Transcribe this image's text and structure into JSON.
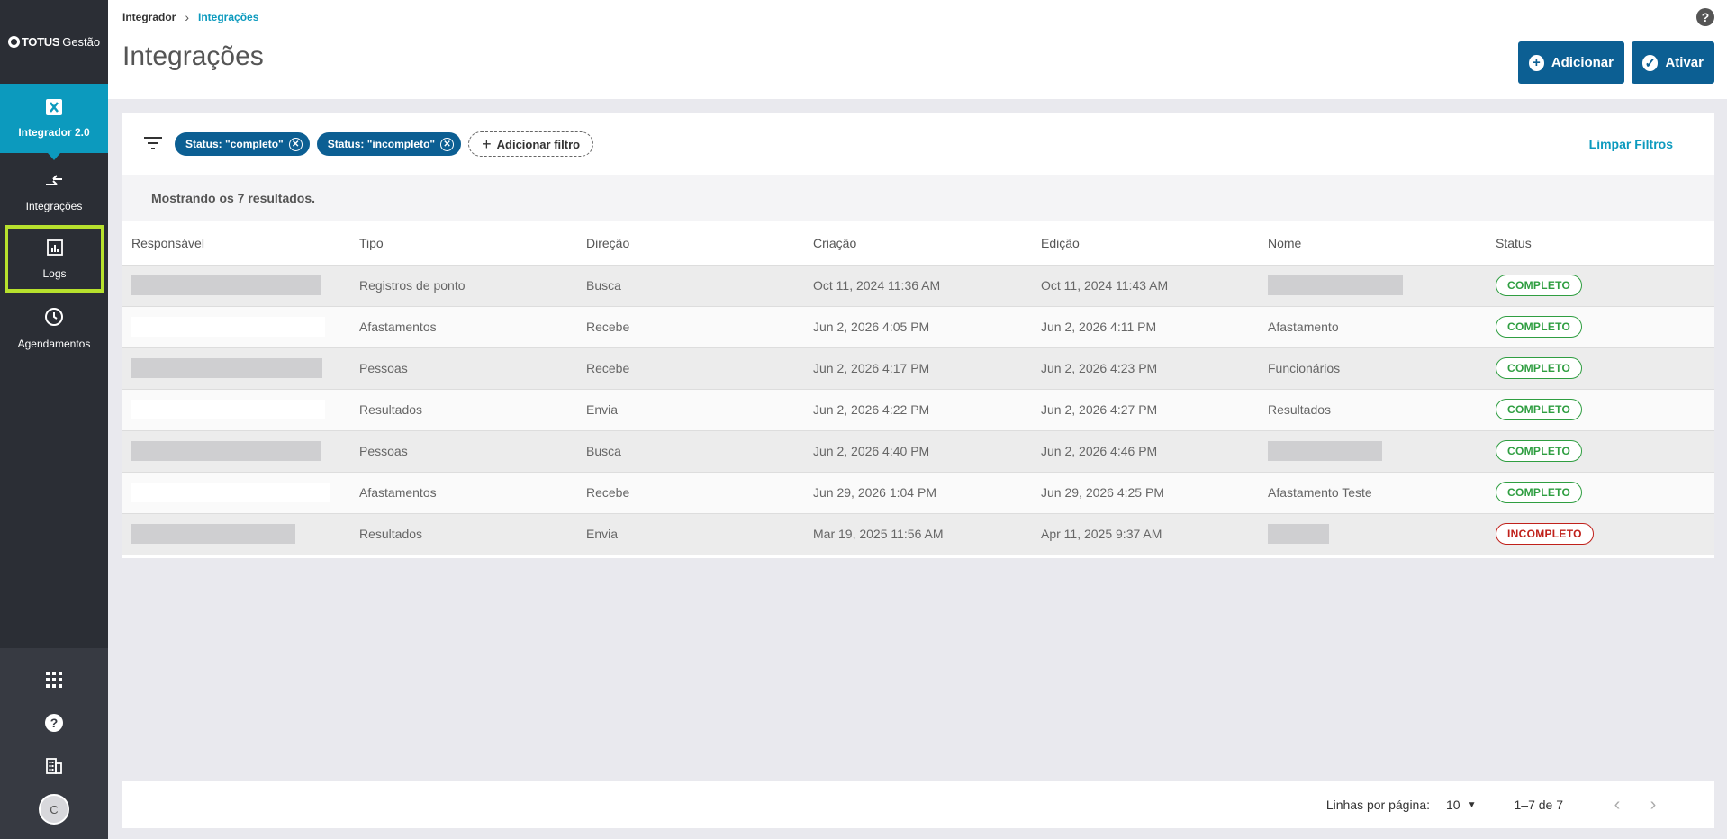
{
  "sidebar": {
    "logo_mark": "TOTUS",
    "logo_product": "Gestão",
    "active": {
      "label": "Integrador 2.0",
      "icon": "integrador-icon"
    },
    "items": [
      {
        "label": "Integrações",
        "icon": "arrows-swap-icon"
      },
      {
        "label": "Logs",
        "icon": "chart-icon"
      },
      {
        "label": "Agendamentos",
        "icon": "clock-icon"
      }
    ],
    "bottom_icons": [
      "apps-grid-icon",
      "help-circle-icon",
      "building-icon"
    ],
    "avatar_initial": "C"
  },
  "header": {
    "breadcrumb": [
      "Integrador",
      "Integrações"
    ],
    "title": "Integrações",
    "buttons": {
      "add": "Adicionar",
      "activate": "Ativar"
    }
  },
  "filters": {
    "chips": [
      "Status: \"completo\"",
      "Status: \"incompleto\""
    ],
    "add_filter": "Adicionar filtro",
    "clear": "Limpar Filtros"
  },
  "results_text": "Mostrando os 7 resultados.",
  "table": {
    "columns": [
      "Responsável",
      "Tipo",
      "Direção",
      "Criação",
      "Edição",
      "Nome",
      "Status"
    ],
    "rows": [
      {
        "tipo": "Registros de ponto",
        "direcao": "Busca",
        "criacao": "Oct 11, 2024 11:36 AM",
        "edicao": "Oct 11, 2024 11:43 AM",
        "nome": "",
        "status": "COMPLETO"
      },
      {
        "tipo": "Afastamentos",
        "direcao": "Recebe",
        "criacao": "Jun 2, 2026 4:05 PM",
        "edicao": "Jun 2, 2026 4:11 PM",
        "nome": "Afastamento",
        "status": "COMPLETO"
      },
      {
        "tipo": "Pessoas",
        "direcao": "Recebe",
        "criacao": "Jun 2, 2026 4:17 PM",
        "edicao": "Jun 2, 2026 4:23 PM",
        "nome": "Funcionários",
        "status": "COMPLETO"
      },
      {
        "tipo": "Resultados",
        "direcao": "Envia",
        "criacao": "Jun 2, 2026 4:22 PM",
        "edicao": "Jun 2, 2026 4:27 PM",
        "nome": "Resultados",
        "status": "COMPLETO"
      },
      {
        "tipo": "Pessoas",
        "direcao": "Busca",
        "criacao": "Jun 2, 2026 4:40 PM",
        "edicao": "Jun 2, 2026 4:46 PM",
        "nome": "",
        "status": "COMPLETO"
      },
      {
        "tipo": "Afastamentos",
        "direcao": "Recebe",
        "criacao": "Jun 29, 2026 1:04 PM",
        "edicao": "Jun 29, 2026 4:25 PM",
        "nome": "Afastamento Teste",
        "status": "COMPLETO"
      },
      {
        "tipo": "Resultados",
        "direcao": "Envia",
        "criacao": "Mar 19, 2025 11:56 AM",
        "edicao": "Apr 11, 2025 9:37 AM",
        "nome": "",
        "status": "INCOMPLETO"
      }
    ]
  },
  "pagination": {
    "rows_label": "Linhas por página:",
    "rows_value": "10",
    "range": "1–7 de 7"
  },
  "colors": {
    "accent": "#0c9abe",
    "primary_button": "#0c5f93",
    "sidebar": "#2b2e35",
    "complete": "#2f9e41",
    "incomplete": "#c0211b",
    "highlight": "#b7e12d"
  }
}
